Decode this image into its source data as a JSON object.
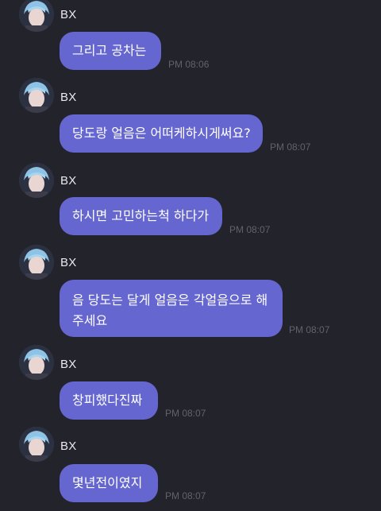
{
  "colors": {
    "background": "#23232b",
    "bubble": "#6566d0",
    "bubble_text": "#ffffff",
    "sender_text": "#e8e8ee",
    "time_text": "#62626c"
  },
  "icons": {
    "avatar": "avatar-icon"
  },
  "messages": [
    {
      "sender": "BX",
      "text": "그리고 공차는",
      "time": "PM 08:06"
    },
    {
      "sender": "BX",
      "text": "당도랑 얼음은 어떠케하시게써요?",
      "time": "PM 08:07"
    },
    {
      "sender": "BX",
      "text": "하시면 고민하는척 하다가",
      "time": "PM 08:07"
    },
    {
      "sender": "BX",
      "text": "음 당도는 달게 얼음은 각얼음으로 해 주세요",
      "time": "PM 08:07"
    },
    {
      "sender": "BX",
      "text": "창피했다진짜",
      "time": "PM 08:07"
    },
    {
      "sender": "BX",
      "text": "몇년전이였지",
      "time": "PM 08:07"
    }
  ]
}
